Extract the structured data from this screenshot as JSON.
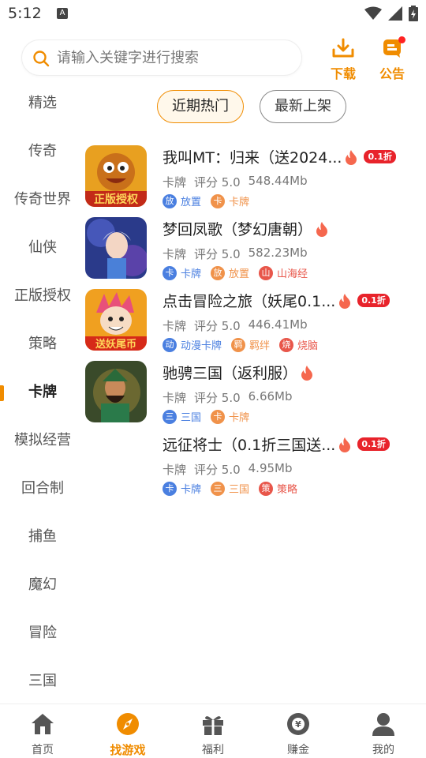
{
  "status": {
    "time": "5:12",
    "a_badge": "A"
  },
  "header": {
    "search_placeholder": "请输入关键字进行搜索",
    "download_label": "下载",
    "notice_label": "公告"
  },
  "sidebar": {
    "items": [
      {
        "label": "精选"
      },
      {
        "label": "传奇"
      },
      {
        "label": "传奇世界"
      },
      {
        "label": "仙侠"
      },
      {
        "label": "正版授权"
      },
      {
        "label": "策略"
      },
      {
        "label": "卡牌",
        "active": true
      },
      {
        "label": "模拟经营"
      },
      {
        "label": "回合制"
      },
      {
        "label": "捕鱼"
      },
      {
        "label": "魔幻"
      },
      {
        "label": "冒险"
      },
      {
        "label": "三国"
      }
    ]
  },
  "tabs": [
    {
      "label": "近期热门",
      "active": true
    },
    {
      "label": "最新上架",
      "active": false
    }
  ],
  "games": [
    {
      "title": "我叫MT：归来（送2024...",
      "hot": true,
      "discount": "0.1折",
      "category": "卡牌",
      "rating": "评分 5.0",
      "size": "548.44Mb",
      "icon": "game-icon-mt",
      "tags": [
        {
          "glyph": "放",
          "text": "放置",
          "color": "#4a7fe0"
        },
        {
          "glyph": "卡",
          "text": "卡牌",
          "color": "#f0924a"
        }
      ]
    },
    {
      "title": "梦回凤歌（梦幻唐朝）",
      "hot": true,
      "discount": "",
      "category": "卡牌",
      "rating": "评分 5.0",
      "size": "582.23Mb",
      "icon": "game-icon-menghui",
      "tags": [
        {
          "glyph": "卡",
          "text": "卡牌",
          "color": "#4a7fe0"
        },
        {
          "glyph": "放",
          "text": "放置",
          "color": "#f0924a"
        },
        {
          "glyph": "山",
          "text": "山海经",
          "color": "#e8564a"
        }
      ]
    },
    {
      "title": "点击冒险之旅（妖尾0.1...",
      "hot": true,
      "discount": "0.1折",
      "category": "卡牌",
      "rating": "评分 5.0",
      "size": "446.41Mb",
      "icon": "game-icon-fairytail",
      "tags": [
        {
          "glyph": "动",
          "text": "动漫卡牌",
          "color": "#4a7fe0"
        },
        {
          "glyph": "羁",
          "text": "羁绊",
          "color": "#f0924a"
        },
        {
          "glyph": "烧",
          "text": "烧脑",
          "color": "#e8564a"
        }
      ]
    },
    {
      "title": "驰骋三国（返利服）",
      "hot": true,
      "discount": "",
      "category": "卡牌",
      "rating": "评分 5.0",
      "size": "6.66Mb",
      "icon": "game-icon-sanguo",
      "tags": [
        {
          "glyph": "三",
          "text": "三国",
          "color": "#4a7fe0"
        },
        {
          "glyph": "卡",
          "text": "卡牌",
          "color": "#f0924a"
        }
      ]
    },
    {
      "title": "远征将士（0.1折三国送...",
      "hot": true,
      "discount": "0.1折",
      "category": "卡牌",
      "rating": "评分 5.0",
      "size": "4.95Mb",
      "icon": "",
      "tags": [
        {
          "glyph": "卡",
          "text": "卡牌",
          "color": "#4a7fe0"
        },
        {
          "glyph": "三",
          "text": "三国",
          "color": "#f0924a"
        },
        {
          "glyph": "策",
          "text": "策略",
          "color": "#e8564a"
        }
      ]
    }
  ],
  "bottom_nav": [
    {
      "label": "首页",
      "icon": "home-icon"
    },
    {
      "label": "找游戏",
      "icon": "compass-icon",
      "active": true
    },
    {
      "label": "福利",
      "icon": "gift-icon"
    },
    {
      "label": "赚金",
      "icon": "coin-icon"
    },
    {
      "label": "我的",
      "icon": "user-icon"
    }
  ],
  "colors": {
    "accent": "#f08c00",
    "discount": "#e8232b"
  }
}
